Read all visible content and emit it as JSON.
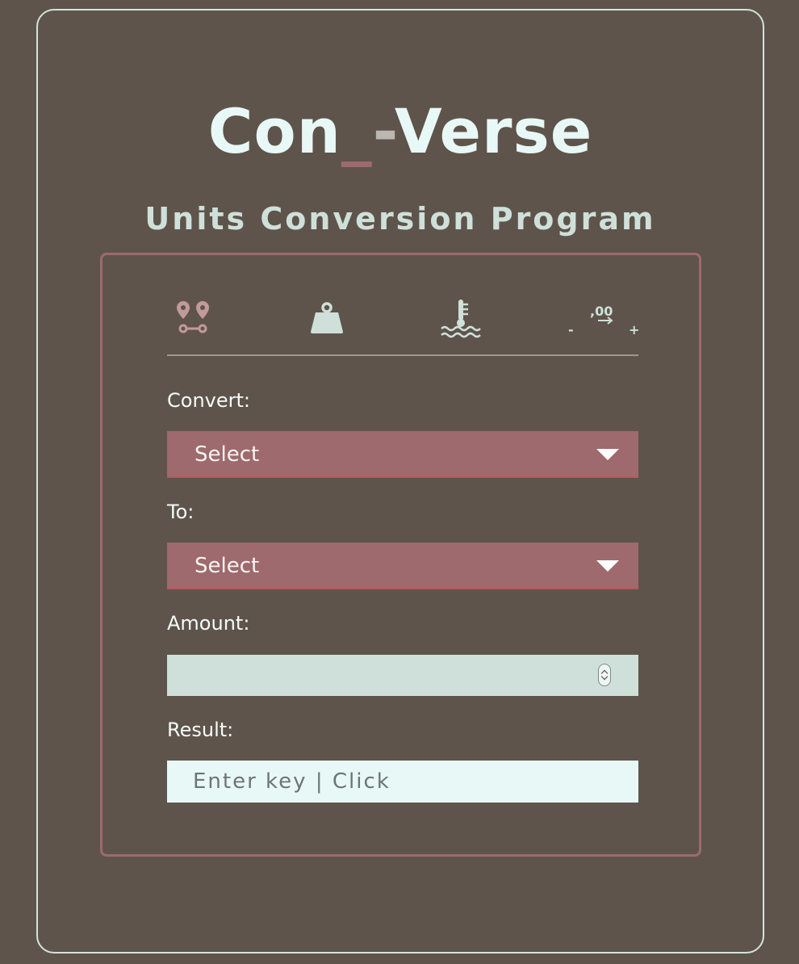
{
  "app": {
    "title_part1": "Con",
    "title_underscore": "_",
    "title_dash": "-",
    "title_part2": "Verse",
    "subtitle": "Units Conversion Program"
  },
  "tabs": [
    {
      "name": "length",
      "icon": "map-pins-route-icon"
    },
    {
      "name": "weight",
      "icon": "weight-icon"
    },
    {
      "name": "temperature",
      "icon": "thermometer-water-icon"
    },
    {
      "name": "decimal",
      "icon": "decimal-precision-icon",
      "decimal_label": ",00",
      "minus": "-",
      "plus": "+"
    }
  ],
  "form": {
    "convert_label": "Convert:",
    "convert_value": "Select",
    "to_label": "To:",
    "to_value": "Select",
    "amount_label": "Amount:",
    "amount_value": "",
    "result_label": "Result:",
    "result_placeholder": "Enter key | Click"
  },
  "colors": {
    "background": "#5e544b",
    "accent_rose": "#9e6a6d",
    "mint": "#cfe0da",
    "light_mint": "#e8f8f6"
  }
}
